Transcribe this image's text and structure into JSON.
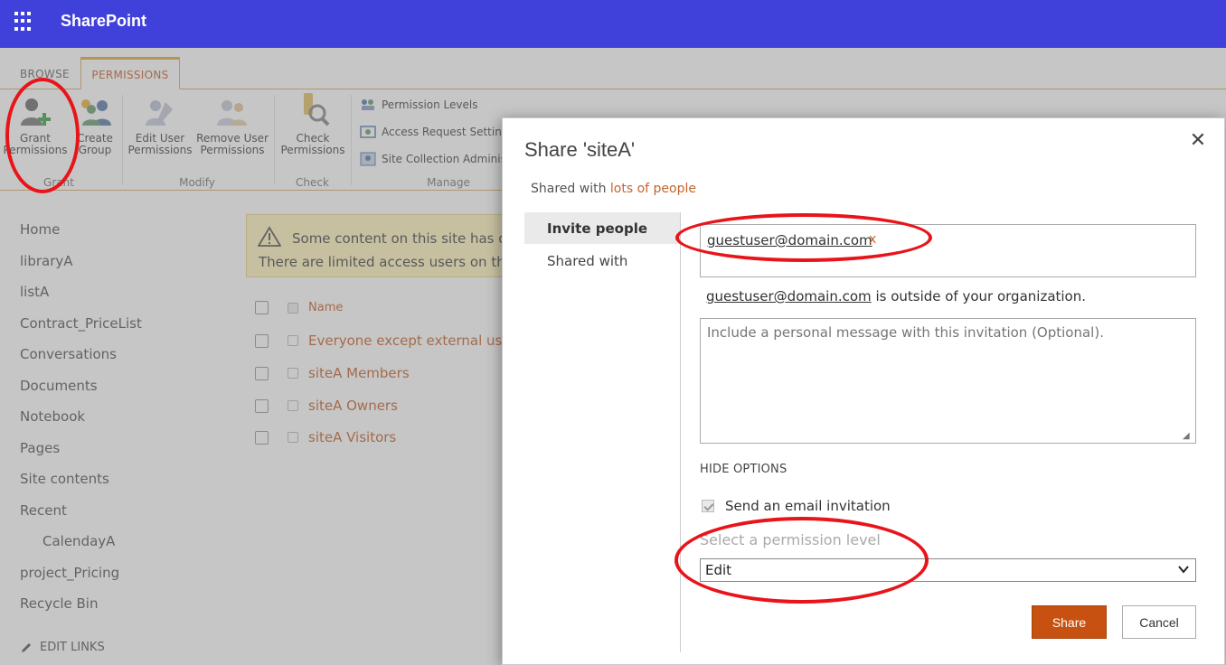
{
  "suitebar": {
    "app_name": "SharePoint",
    "waffle_icon": "app-launcher-icon",
    "color": "#4040da"
  },
  "ribbon": {
    "tabs": [
      {
        "label": "BROWSE"
      },
      {
        "label": "PERMISSIONS",
        "active": true
      }
    ],
    "buttons": {
      "grant": {
        "line1": "Grant",
        "line2": "Permissions"
      },
      "create_group": {
        "line1": "Create",
        "line2": "Group"
      },
      "edit_user": {
        "line1": "Edit User",
        "line2": "Permissions"
      },
      "remove_user": {
        "line1": "Remove User",
        "line2": "Permissions"
      },
      "check": {
        "line1": "Check",
        "line2": "Permissions"
      }
    },
    "manage_items": [
      "Permission Levels",
      "Access Request Settings",
      "Site Collection Administrators"
    ],
    "groups": {
      "grant": "Grant",
      "modify": "Modify",
      "check": "Check",
      "manage": "Manage"
    },
    "accent_color": "#e7a83e"
  },
  "leftnav": {
    "items": [
      "Home",
      "libraryA",
      "listA",
      "Contract_PriceList",
      "Conversations",
      "Documents",
      "Notebook",
      "Pages",
      "Site contents",
      "Recent",
      "CalendayA",
      "project_Pricing",
      "Recycle Bin"
    ],
    "edit_links": "EDIT LINKS"
  },
  "warning": {
    "line1": "Some content on this site has different permissions from what you see here.",
    "line2": "There are limited access users on this site."
  },
  "groups_list": {
    "header": "Name",
    "rows": [
      "Everyone except external users",
      "siteA Members",
      "siteA Owners",
      "siteA Visitors"
    ]
  },
  "dialog": {
    "title": "Share 'siteA'",
    "close_glyph": "✕",
    "shared_with_prefix": "Shared with",
    "shared_with_link": "lots of people",
    "tabs": [
      {
        "label": "Invite people",
        "active": true
      },
      {
        "label": "Shared with"
      }
    ],
    "invitee": "guestuser@domain.com",
    "remove_token": "x",
    "outside_email": "guestuser@domain.com",
    "outside_suffix": "is outside of your organization.",
    "message_placeholder": "Include a personal message with this invitation (Optional).",
    "hide_options": "HIDE OPTIONS",
    "send_email_label": "Send an email invitation",
    "send_email_checked": true,
    "permission_label": "Select a permission level",
    "permission_value": "Edit",
    "share_button": "Share",
    "cancel_button": "Cancel",
    "share_color": "#c65111"
  },
  "annotation_color": "#e8141a"
}
